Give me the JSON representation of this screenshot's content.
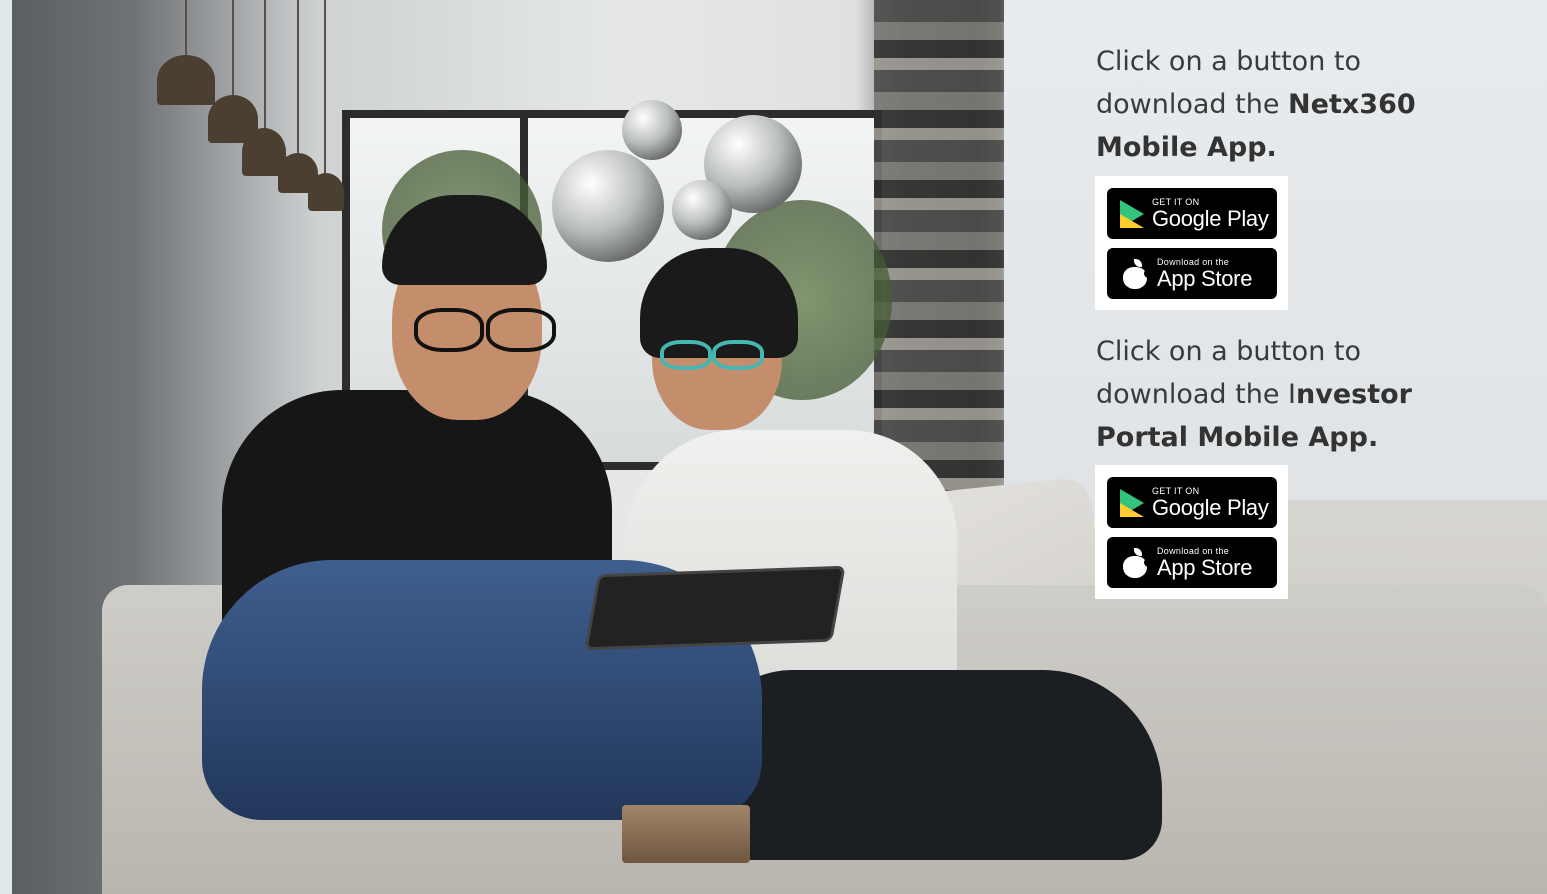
{
  "section1": {
    "prefix": "Click on a button to download the ",
    "app_name": "Netx360 Mobile App."
  },
  "section2": {
    "prefix": "Click on a button to download the I",
    "app_name": "nvestor Portal Mobile App."
  },
  "badges": {
    "google_play": {
      "small": "GET IT ON",
      "big": "Google Play"
    },
    "app_store": {
      "small": "Download on the",
      "big": "App Store"
    }
  },
  "icons": {
    "google_play": "google-play-icon",
    "app_store": "apple-icon"
  }
}
